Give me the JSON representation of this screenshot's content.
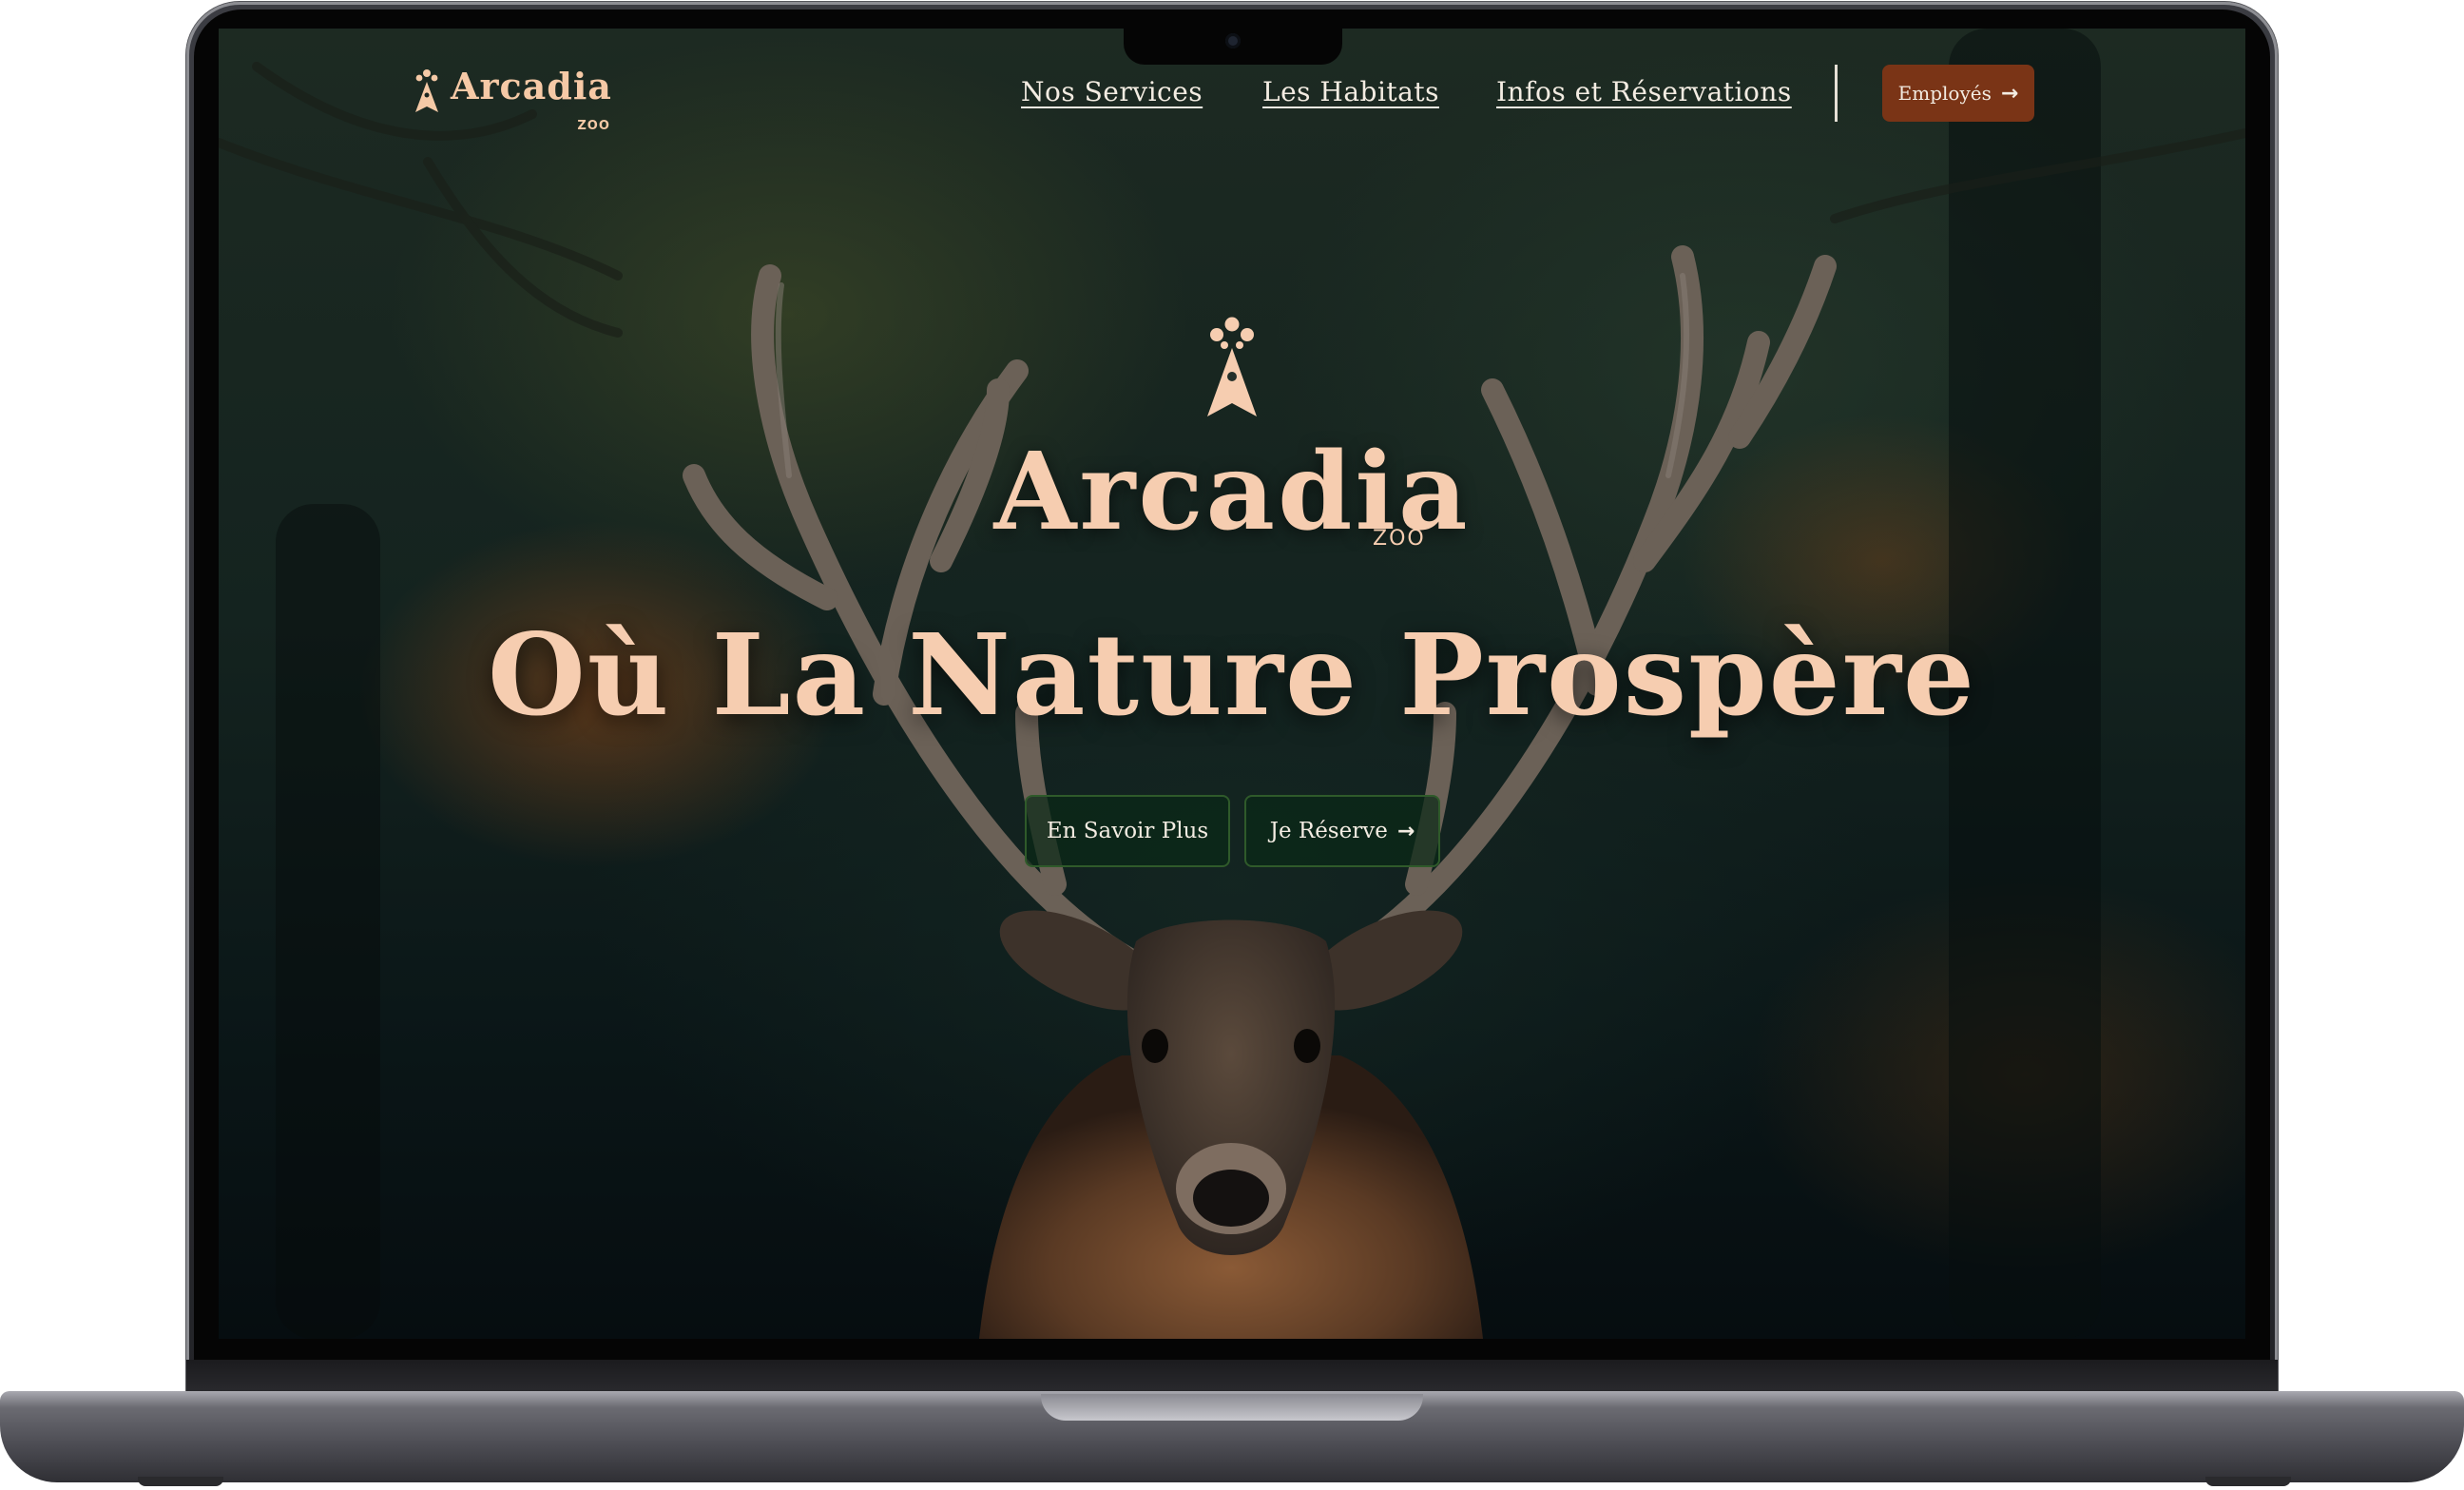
{
  "brand": {
    "name": "Arcadia",
    "sub": "ZOO",
    "accent": "#f6cdb0",
    "cta_color": "#7a3416"
  },
  "nav": {
    "links": [
      "Nos Services",
      "Les Habitats",
      "Infos et Réservations"
    ],
    "employes_label": "Employés"
  },
  "hero": {
    "logo": "Arcadia",
    "logo_sub": "ZOO",
    "title": "Où La Nature  Prospère",
    "buttons": {
      "more": "En Savoir Plus",
      "reserve": "Je Réserve"
    }
  },
  "icons": {
    "logo_mark": "ermine-logo-icon",
    "arrow": "arrow-right-icon"
  }
}
